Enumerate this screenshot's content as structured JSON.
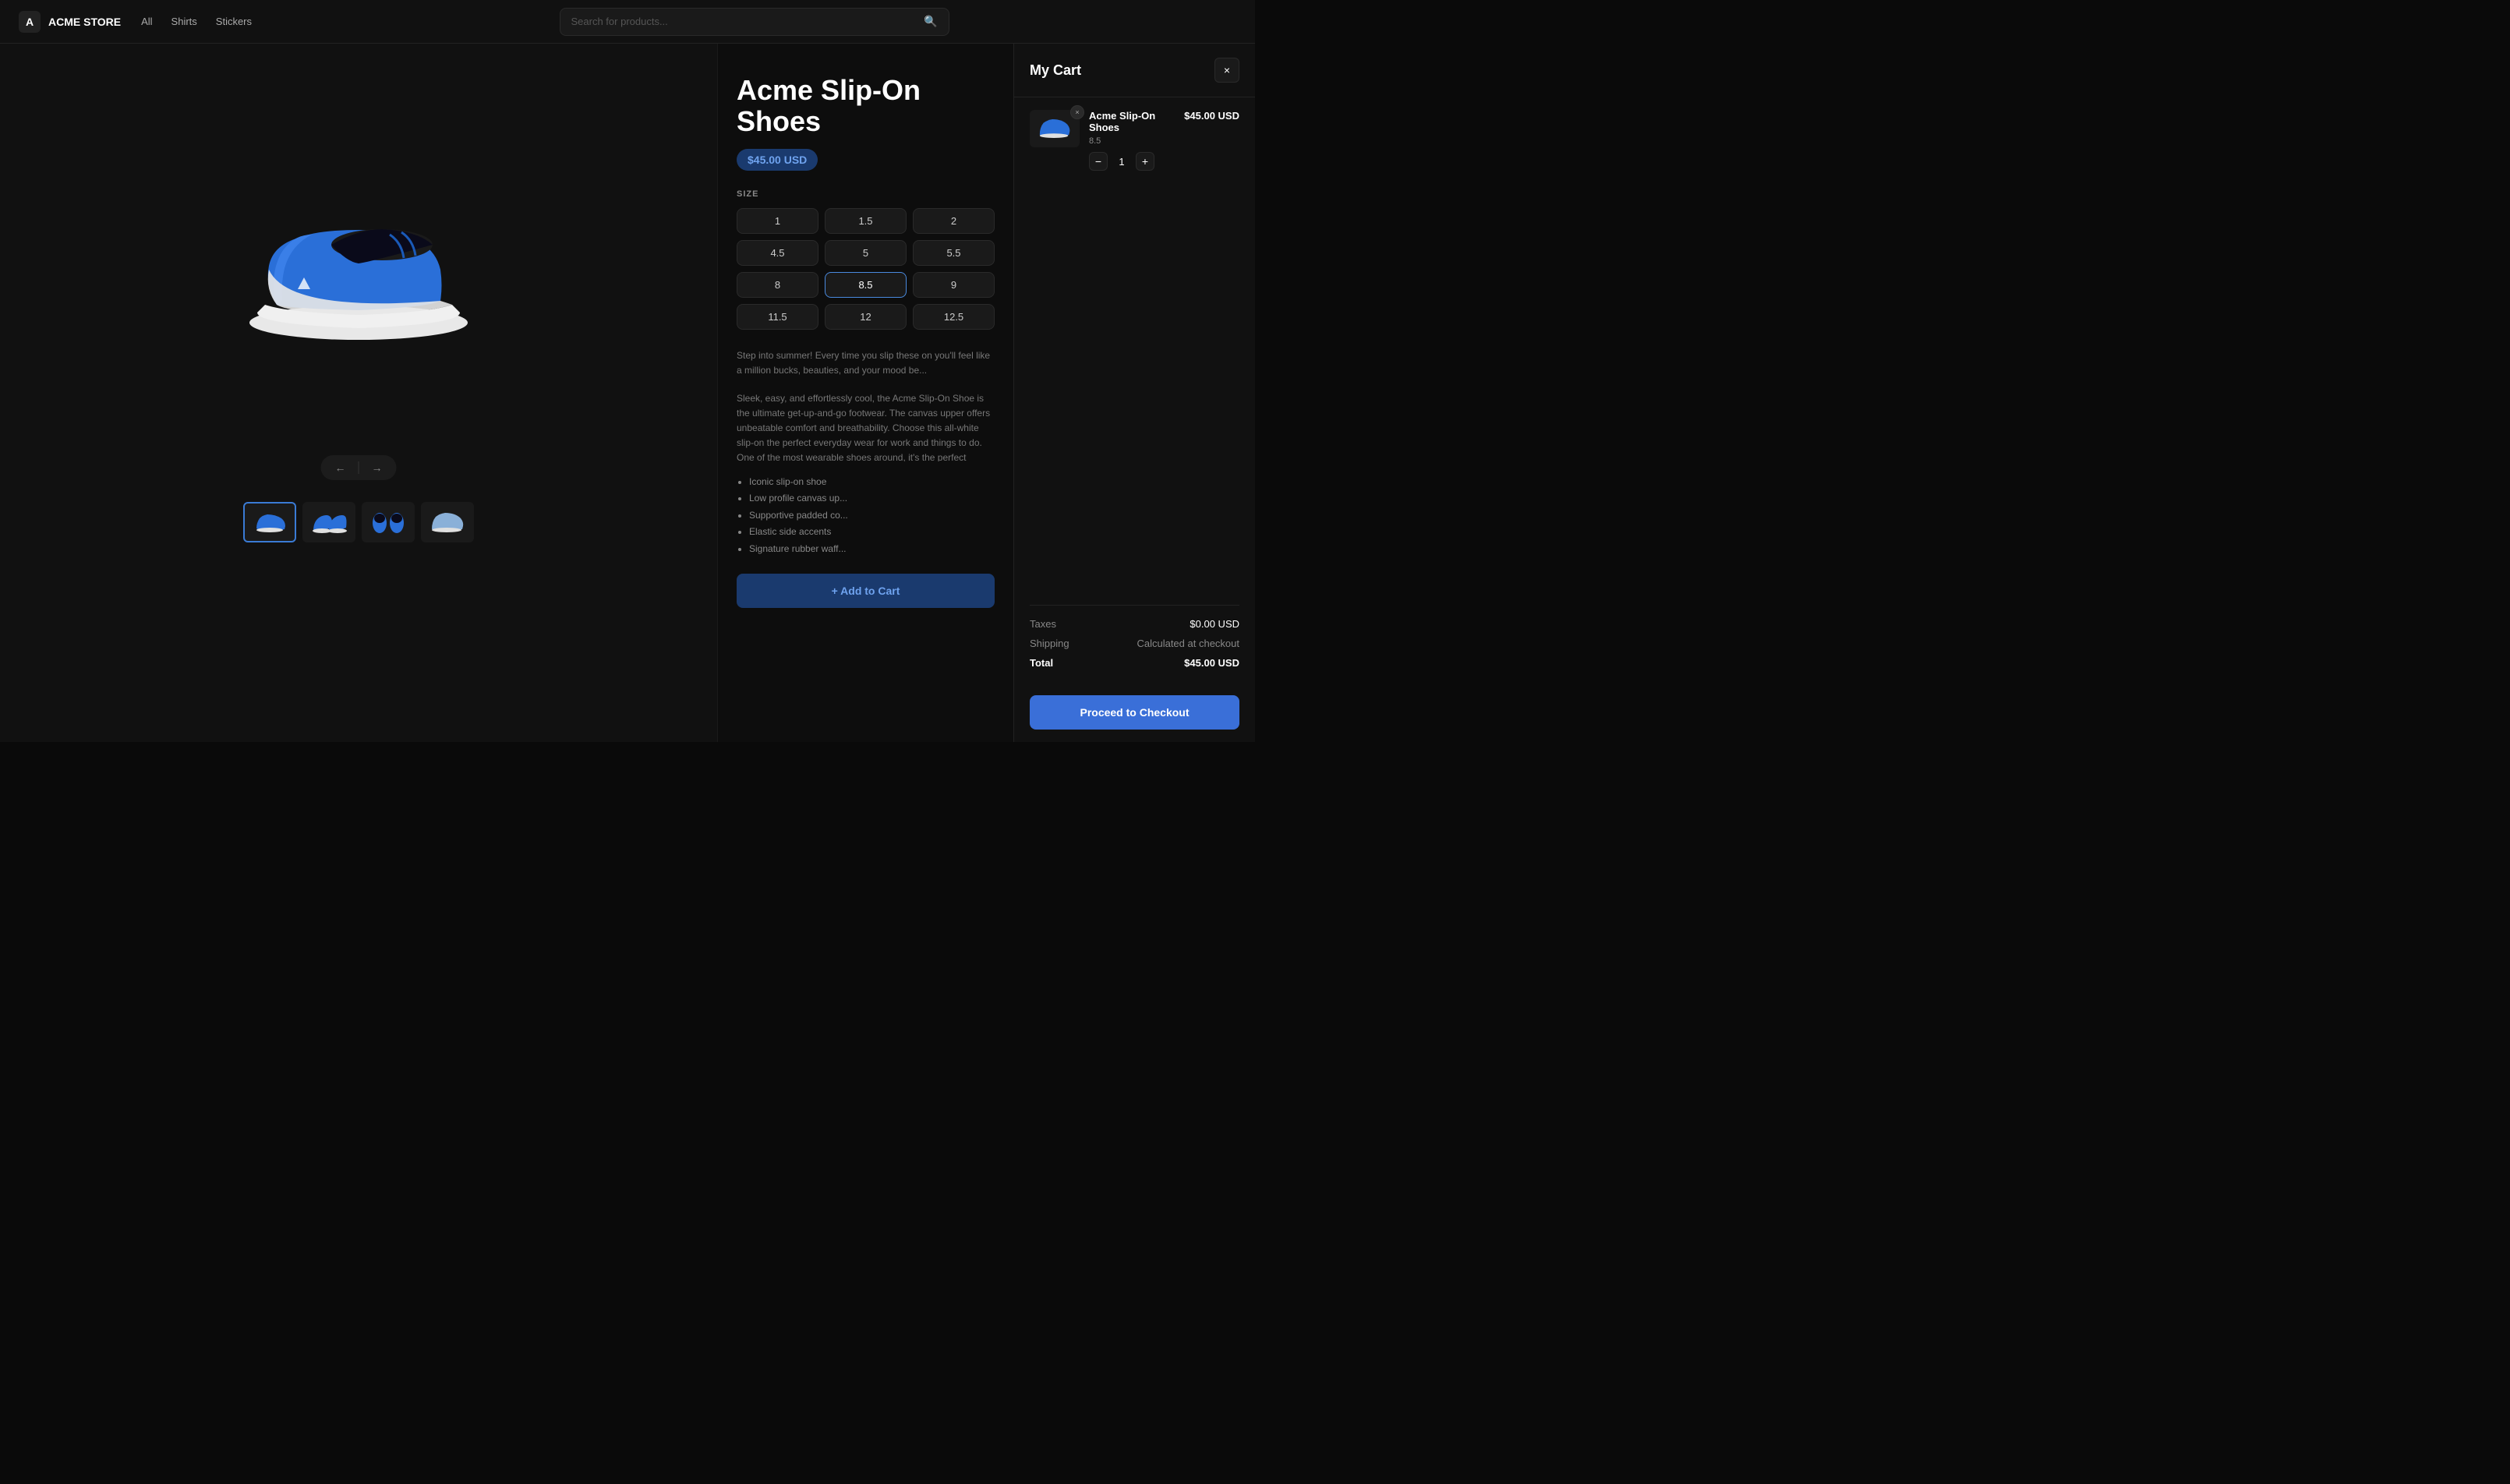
{
  "navbar": {
    "logo_icon": "A",
    "store_name": "ACME STORE",
    "links": [
      {
        "label": "All",
        "active": false
      },
      {
        "label": "Shirts",
        "active": false
      },
      {
        "label": "Stickers",
        "active": false
      }
    ],
    "search_placeholder": "Search for products..."
  },
  "product": {
    "title": "Acme Slip-On Shoes",
    "price": "$45.00 USD",
    "size_label": "SIZE",
    "sizes": [
      {
        "value": "1",
        "selected": false
      },
      {
        "value": "1.5",
        "selected": false
      },
      {
        "value": "2",
        "selected": false
      },
      {
        "value": "4.5",
        "selected": false
      },
      {
        "value": "5",
        "selected": false
      },
      {
        "value": "5.5",
        "selected": false
      },
      {
        "value": "8",
        "selected": false
      },
      {
        "value": "8.5",
        "selected": true
      },
      {
        "value": "9",
        "selected": false
      },
      {
        "value": "11.5",
        "selected": false
      },
      {
        "value": "12",
        "selected": false
      },
      {
        "value": "12.5",
        "selected": false
      }
    ],
    "description_1": "Step into summer! Every time you slip these on you'll feel like a million bucks, beauties, and your mood be...",
    "description_2": "Sleek, easy, and effortlessly cool, the Acme Slip-On Shoe is the ultimate get-up-and-go footwear. The canvas upper offers unbeatable comfort and breathability. Choose this all-white slip-on the perfect everyday wear for work and things to do. One of the most wearable shoes around, it's the perfect middle ground b...",
    "features": [
      "Iconic slip-on shoe",
      "Low profile canvas up...",
      "Supportive padded co...",
      "Elastic side accents",
      "Signature rubber waff..."
    ],
    "add_btn_label": "+ Add to Cart"
  },
  "cart": {
    "title": "My Cart",
    "close_icon": "×",
    "items": [
      {
        "name": "Acme Slip-On Shoes",
        "price": "$45.00 USD",
        "size": "8.5",
        "quantity": 1,
        "remove_icon": "×"
      }
    ],
    "taxes_label": "Taxes",
    "taxes_value": "$0.00 USD",
    "shipping_label": "Shipping",
    "shipping_value": "Calculated at checkout",
    "total_label": "Total",
    "total_value": "$45.00 USD",
    "checkout_btn": "Proceed to Checkout"
  }
}
